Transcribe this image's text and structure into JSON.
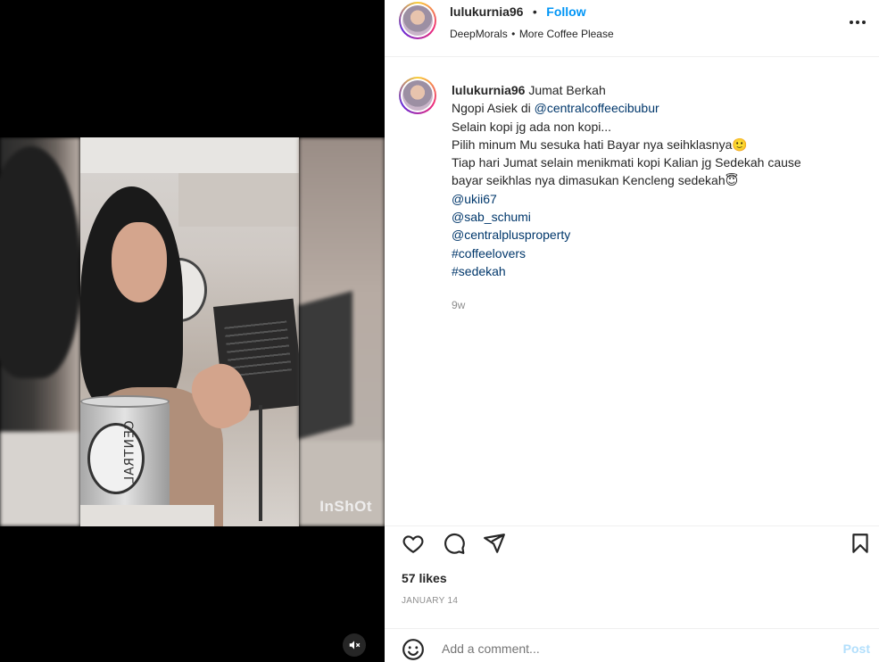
{
  "post": {
    "username": "lulukurnia96",
    "follow_label": "Follow",
    "separator": "•",
    "audio_artist": "DeepMorals",
    "audio_separator": "•",
    "audio_track": "More Coffee Please"
  },
  "media": {
    "watermark": "InShOt",
    "cup_text": "CENTRAL",
    "icons": {
      "mute": "speaker-muted-icon"
    }
  },
  "caption": {
    "username": "lulukurnia96",
    "line1_text": "Jumat Berkah",
    "line2_text": "Ngopi Asiek di ",
    "line2_mention": "@centralcoffeecibubur",
    "line3": "Selain kopi jg ada non kopi...",
    "line4": "Pilih minum Mu sesuka hati Bayar nya seihklasnya🙂",
    "line5": "Tiap hari Jumat selain menikmati kopi Kalian jg Sedekah cause",
    "line6": "bayar seikhlas nya dimasukan Kencleng sedekah😇",
    "mention1": "@ukii67",
    "mention2": "@sab_schumi",
    "mention3": "@centralplusproperty",
    "hashtag1": "#coffeelovers",
    "hashtag2": "#sedekah",
    "time": "9w"
  },
  "engagement": {
    "likes": "57 likes",
    "date": "JANUARY 14",
    "icons": [
      "heart-icon",
      "comment-icon",
      "share-icon",
      "bookmark-icon"
    ]
  },
  "comment": {
    "placeholder": "Add a comment...",
    "post_label": "Post",
    "icon": "emoji-icon"
  },
  "colors": {
    "link": "#00376b",
    "follow": "#0095f6",
    "muted": "#8e8e8e",
    "post_disabled": "#b2dffc"
  }
}
